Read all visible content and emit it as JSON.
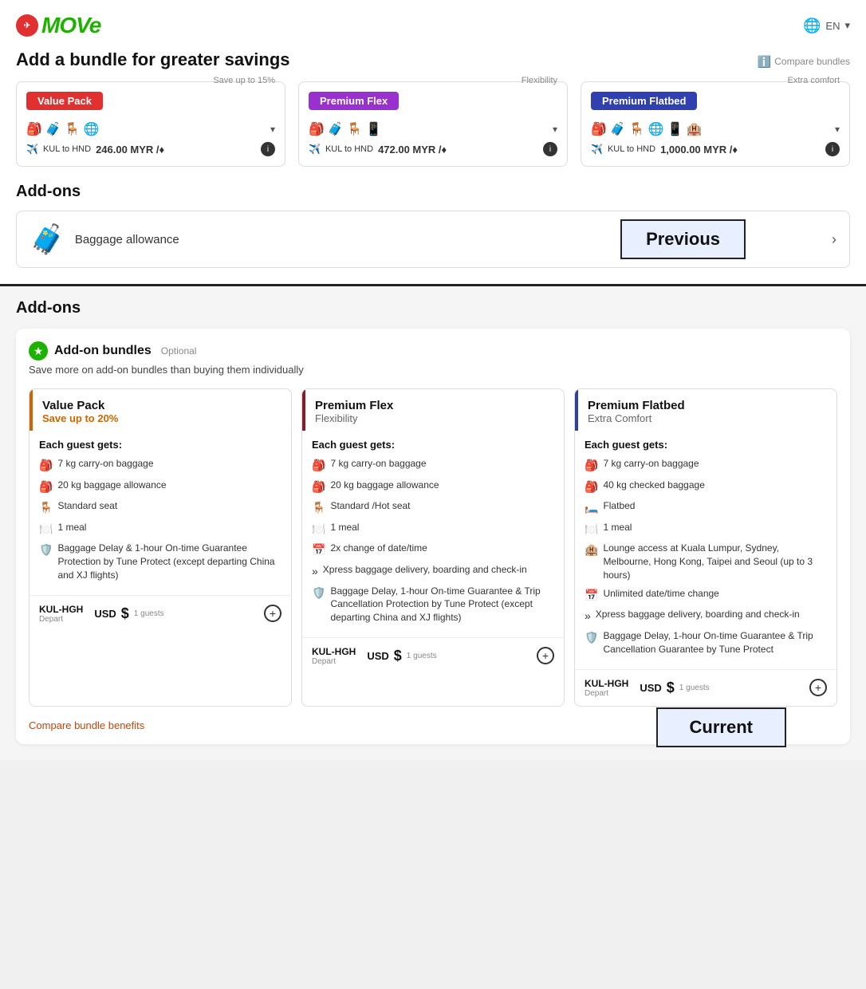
{
  "header": {
    "logo_text": "MOVe",
    "lang": "EN"
  },
  "top": {
    "title": "Add a bundle for greater savings",
    "compare_link": "Compare bundles",
    "bundles": [
      {
        "name": "Value Pack",
        "subtitle": "Save up to 15%",
        "tag_class": "tag-red",
        "icons": "🎒🧳🪑🌐",
        "route": "KUL to HND",
        "price": "246.00",
        "currency": "MYR",
        "per": "/ ♦"
      },
      {
        "name": "Premium Flex",
        "subtitle": "Flexibility",
        "tag_class": "tag-purple",
        "icons": "🎒🧳🪑📱",
        "route": "KUL to HND",
        "price": "472.00",
        "currency": "MYR",
        "per": "/ ♦"
      },
      {
        "name": "Premium Flatbed",
        "subtitle": "Extra comfort",
        "tag_class": "tag-navy",
        "icons": "🎒🧳🪑🌐📱🏨",
        "route": "KUL to HND",
        "price": "1,000.00",
        "currency": "MYR",
        "per": "/ ♦"
      }
    ],
    "addons_title": "Add-ons",
    "baggage_label": "Baggage allowance",
    "previous_label": "Previous"
  },
  "bottom": {
    "title": "Add-ons",
    "bundle_section_label": "Add-on bundles",
    "optional_text": "Optional",
    "save_more_text": "Save more on add-on bundles than buying them individually",
    "bundles": [
      {
        "name": "Value Pack",
        "sub": "Save up to 20%",
        "sub_class": "sub-orange",
        "header_class": "header-orange",
        "each_guest": "Each guest gets:",
        "features": [
          {
            "icon": "🎒",
            "text": "7 kg carry-on baggage"
          },
          {
            "icon": "🎒",
            "text": "20 kg baggage allowance"
          },
          {
            "icon": "🪑",
            "text": "Standard seat"
          },
          {
            "icon": "🍽️",
            "text": "1 meal"
          },
          {
            "icon": "🛡️",
            "text": "Baggage Delay & 1-hour On-time Guarantee Protection by Tune Protect (except departing China and XJ flights)"
          }
        ],
        "route": "KUL-HGH",
        "route_sub": "Depart",
        "currency": "USD",
        "dollar": "$",
        "guests": "1 guests"
      },
      {
        "name": "Premium Flex",
        "sub": "Flexibility",
        "sub_class": "sub-gray",
        "header_class": "header-maroon",
        "each_guest": "Each guest gets:",
        "features": [
          {
            "icon": "🎒",
            "text": "7 kg carry-on baggage"
          },
          {
            "icon": "🎒",
            "text": "20 kg baggage allowance"
          },
          {
            "icon": "🪑",
            "text": "Standard /Hot seat"
          },
          {
            "icon": "🍽️",
            "text": "1 meal"
          },
          {
            "icon": "📅",
            "text": "2x change of date/time"
          },
          {
            "icon": "»",
            "text": "Xpress baggage delivery, boarding and check-in"
          },
          {
            "icon": "🛡️",
            "text": "Baggage Delay, 1-hour On-time Guarantee & Trip Cancellation Protection by Tune Protect (except departing China and XJ flights)"
          }
        ],
        "route": "KUL-HGH",
        "route_sub": "Depart",
        "currency": "USD",
        "dollar": "$",
        "guests": "1 guests"
      },
      {
        "name": "Premium Flatbed",
        "sub": "Extra Comfort",
        "sub_class": "sub-gray",
        "header_class": "header-navy",
        "each_guest": "Each guest gets:",
        "features": [
          {
            "icon": "🎒",
            "text": "7 kg carry-on baggage"
          },
          {
            "icon": "🎒",
            "text": "40 kg checked baggage"
          },
          {
            "icon": "🛏️",
            "text": "Flatbed"
          },
          {
            "icon": "🍽️",
            "text": "1 meal"
          },
          {
            "icon": "🏨",
            "text": "Lounge access at Kuala Lumpur, Sydney, Melbourne, Hong Kong, Taipei and Seoul (up to 3 hours)"
          },
          {
            "icon": "📅",
            "text": "Unlimited date/time change"
          },
          {
            "icon": "»",
            "text": "Xpress baggage delivery, boarding and check-in"
          },
          {
            "icon": "🛡️",
            "text": "Baggage Delay, 1-hour On-time Guarantee & Trip Cancellation Guarantee by Tune Protect"
          }
        ],
        "route": "KUL-HGH",
        "route_sub": "Depart",
        "currency": "USD",
        "dollar": "$",
        "guests": "1 guests"
      }
    ],
    "compare_benefits_label": "Compare bundle benefits",
    "current_label": "Current"
  }
}
